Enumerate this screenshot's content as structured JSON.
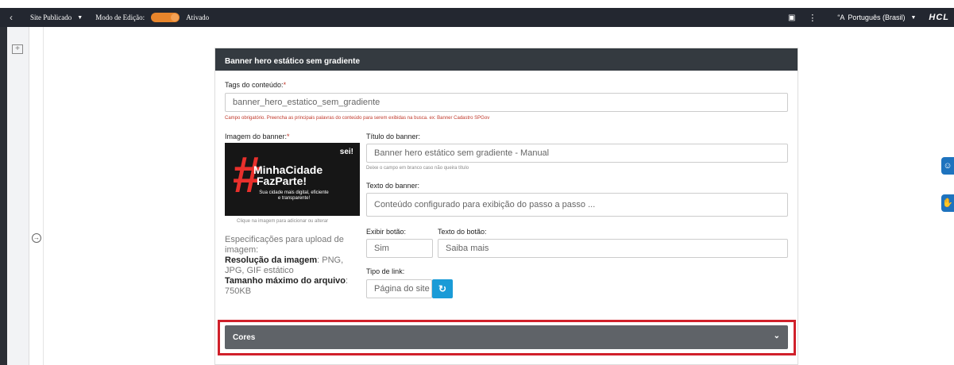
{
  "topbar": {
    "back_icon": "chevron-left-icon",
    "site_status": "Site Publicado",
    "edit_mode_label": "Modo de Edição:",
    "edit_mode_state": "Ativado",
    "language": "Português (Brasil)",
    "brand": "HCL"
  },
  "card": {
    "title": "Banner hero estático sem gradiente",
    "tags_label": "Tags do conteúdo:",
    "tags_required_mark": "*",
    "tags_value": "banner_hero_estatico_sem_gradiente",
    "tags_help": "Campo obrigatório. Preencha as principais palavras do conteúdo para serem exibidas na busca. ex: Banner Cadastro SPGov",
    "image_label": "Imagem do banner:",
    "image_required_mark": "*",
    "image_help": "Clique na imagem para adicionar ou alterar",
    "banner_image": {
      "hash": "#",
      "line1": "MinhaCidade",
      "line2": "FazParte!",
      "subtitle": "Sua cidade mais digital, eficiente e transparente!",
      "brand": "sei!"
    },
    "title_label": "Título do banner:",
    "title_value": "Banner hero estático sem gradiente - Manual",
    "title_help": "Deixe o campo em branco caso não queira título",
    "text_label": "Texto do banner:",
    "text_value": "Conteúdo configurado para exibição do passo a passo ...",
    "show_button_label": "Exibir botão:",
    "show_button_value": "Sim",
    "button_text_label": "Texto do botão:",
    "button_text_value": "Saiba mais",
    "link_type_label": "Tipo de link:",
    "link_type_value": "Página do site",
    "spec_title": "Especificações para upload de imagem:",
    "spec_resolution_label": "Resolução da imagem",
    "spec_resolution_value": ": PNG, JPG, GIF estático",
    "spec_size_label": "Tamanho máximo do arquivo",
    "spec_size_value": ": 750KB",
    "colors_section": "Cores"
  },
  "colors": {
    "topbar": "#232730",
    "accent_toggle": "#e8852b",
    "card_header": "#343a40",
    "required": "#c0392b",
    "refresh_button": "#1a9bd7",
    "highlight": "#d0202a",
    "accordion": "#5f6368"
  }
}
